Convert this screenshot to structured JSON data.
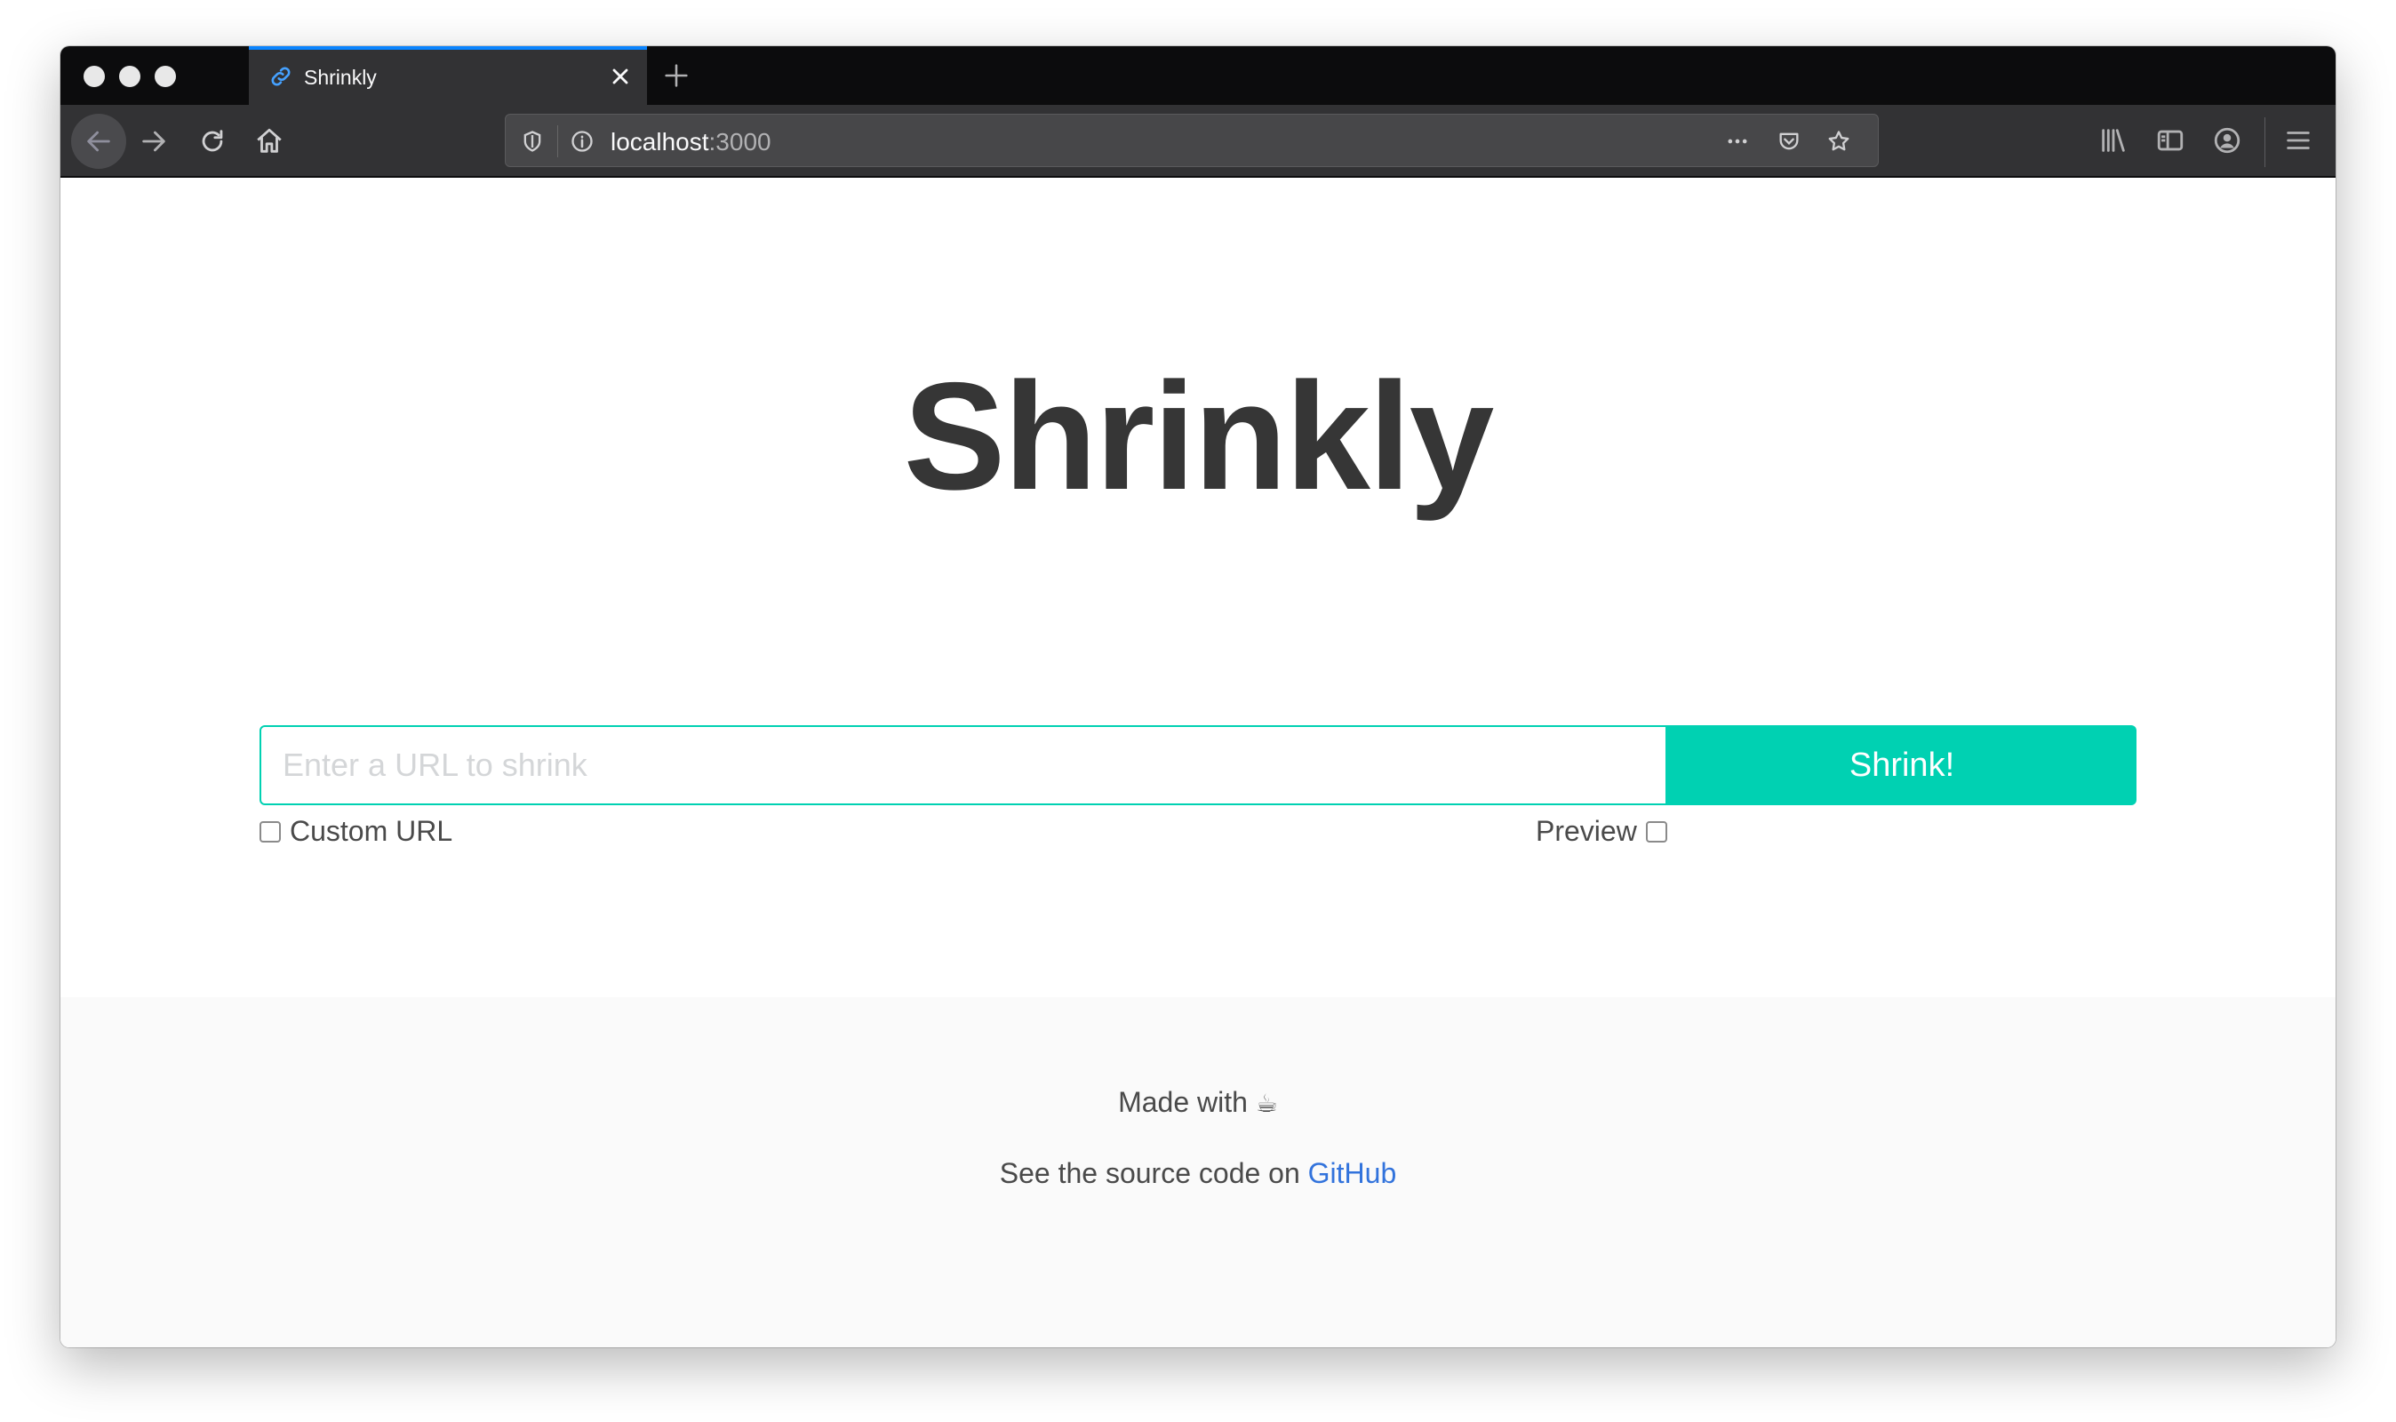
{
  "browser": {
    "tab": {
      "title": "Shrinkly",
      "icon": "link-icon"
    },
    "url": {
      "host": "localhost",
      "port": ":3000"
    },
    "colors": {
      "accent": "#0a84ff",
      "chrome": "#323234"
    }
  },
  "main": {
    "title": "Shrinkly",
    "input_placeholder": "Enter a URL to shrink",
    "input_value": "",
    "submit_label": "Shrink!",
    "custom_url_label": "Custom URL",
    "preview_label": "Preview",
    "custom_url_checked": false,
    "preview_checked": false,
    "accent_color": "#00d1b2"
  },
  "footer": {
    "made_with": "Made with",
    "made_with_icon": "☕",
    "source_prefix": "See the source code on",
    "source_link": "GitHub",
    "link_color": "#3273dc"
  }
}
